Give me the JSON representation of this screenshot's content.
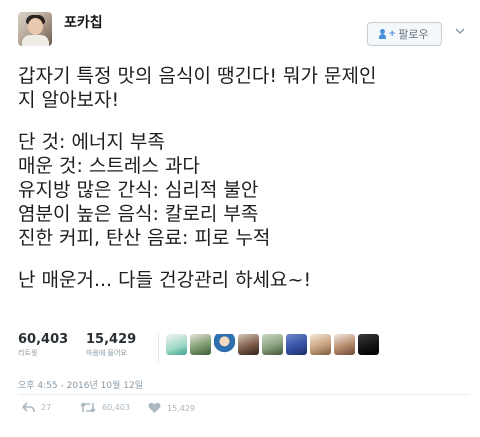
{
  "user": {
    "display_name": "포카칩"
  },
  "follow_button": {
    "label": "팔로우"
  },
  "tweet": {
    "lines": [
      "갑자기 특정 맛의 음식이 땡긴다! 뭐가 문제인",
      "지 알아보자!",
      "",
      "단 것: 에너지 부족",
      "매운 것: 스트레스 과다",
      "유지방 많은 간식: 심리적 불안",
      "염분이 높은 음식: 칼로리 부족",
      "진한 커피, 탄산 음료: 피로 누적",
      "",
      "난 매운거... 다들 건강관리 하세요~!"
    ]
  },
  "stats": {
    "retweets": {
      "count": "60,403",
      "label": "리트윗"
    },
    "likes": {
      "count": "15,429",
      "label": "마음에 들어요"
    }
  },
  "timestamp": "오후 4:55 - 2016년 10월 12일",
  "actions": {
    "reply_count": "27",
    "retweet_count": "60,403",
    "like_count": "15,429"
  },
  "colors": {
    "text": "#1c1e21",
    "muted": "#8899a6",
    "icon": "#aab8c2",
    "accent": "#4a90d9",
    "border": "#e6ecf0"
  },
  "icons": [
    "user-plus-icon",
    "chevron-down-icon",
    "reply-icon",
    "retweet-icon",
    "heart-icon"
  ]
}
